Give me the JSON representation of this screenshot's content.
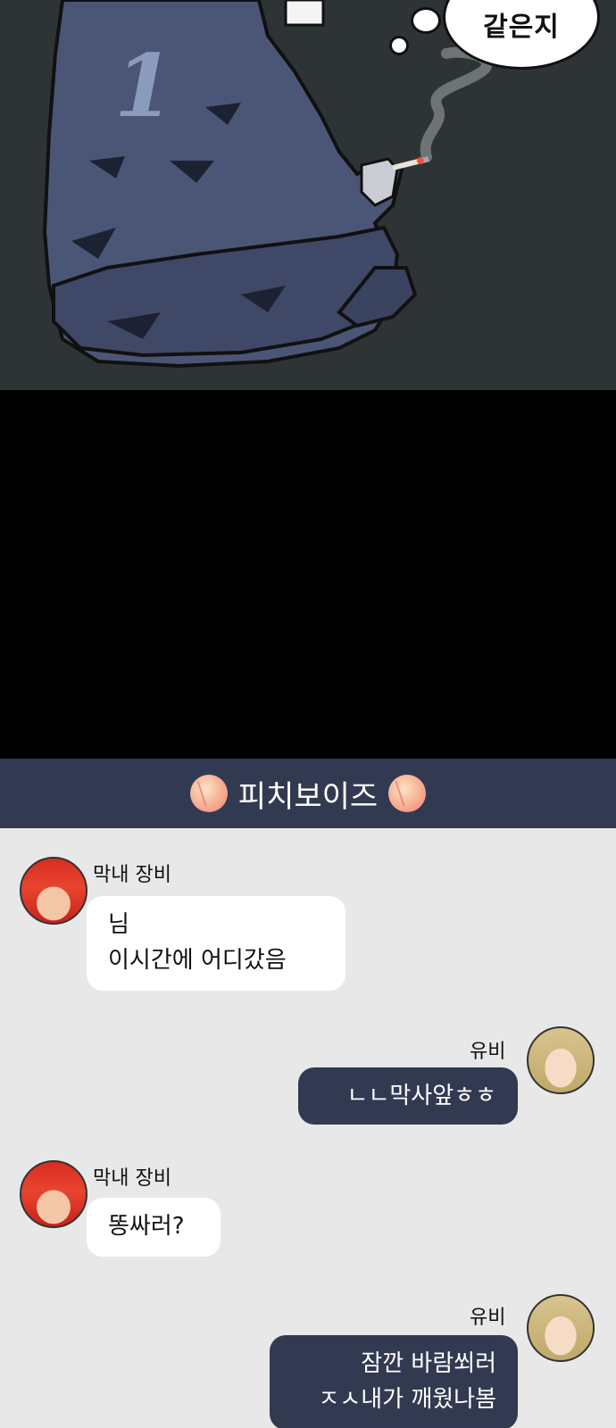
{
  "comic": {
    "speech_text": "같은지",
    "jersey_number": "1"
  },
  "chat": {
    "title": "피치보이즈",
    "icon": "peach-icon",
    "colors": {
      "header_bg": "#323a52",
      "body_bg": "#e8e8e8",
      "incoming_bubble": "#ffffff",
      "outgoing_bubble": "#323a52"
    },
    "messages": [
      {
        "sender": "막내 장비",
        "direction": "incoming",
        "lines": [
          "님",
          "이시간에 어디갔음"
        ]
      },
      {
        "sender": "유비",
        "direction": "outgoing",
        "lines": [
          "ㄴㄴ막사앞ㅎㅎ"
        ]
      },
      {
        "sender": "막내 장비",
        "direction": "incoming",
        "lines": [
          "똥싸러?"
        ]
      },
      {
        "sender": "유비",
        "direction": "outgoing",
        "lines": [
          "잠깐 바람쐬러",
          "ㅈㅅ내가 깨웠나봄"
        ]
      }
    ]
  }
}
